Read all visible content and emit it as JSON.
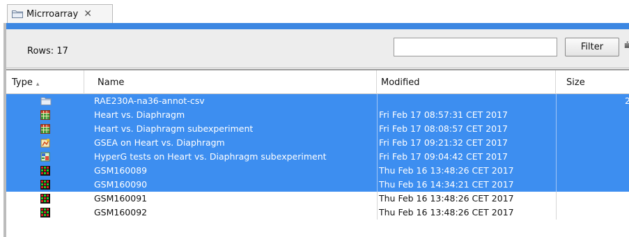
{
  "tab": {
    "label": "Micrroarray",
    "close": "✕"
  },
  "toolbar": {
    "rows_label": "Rows: 17",
    "filter_value": "",
    "filter_button": "Filter"
  },
  "columns": {
    "type": "Type",
    "name": "Name",
    "modified": "Modified",
    "size": "Size"
  },
  "colors": {
    "selection": "#3d8ef0",
    "header_bar": "#3c87e2"
  },
  "rows": [
    {
      "icon": "folder-icon",
      "name": "RAE230A-na36-annot-csv",
      "modified": "",
      "size": "2",
      "selected": true
    },
    {
      "icon": "table-grid-icon",
      "name": "Heart vs. Diaphragm",
      "modified": "Fri Feb 17 08:57:31 CET 2017",
      "size": "",
      "selected": true
    },
    {
      "icon": "table-grid-icon",
      "name": "Heart vs. Diaphragm subexperiment",
      "modified": "Fri Feb 17 08:08:57 CET 2017",
      "size": "",
      "selected": true
    },
    {
      "icon": "gsea-analysis-icon",
      "name": "GSEA on Heart vs. Diaphragm",
      "modified": "Fri Feb 17 09:21:32 CET 2017",
      "size": "",
      "selected": true
    },
    {
      "icon": "hyperg-analysis-icon",
      "name": "HyperG tests on Heart vs. Diaphragm subexperiment",
      "modified": "Fri Feb 17 09:04:42 CET 2017",
      "size": "",
      "selected": true
    },
    {
      "icon": "microarray-chip-icon",
      "name": "GSM160089",
      "modified": "Thu Feb 16 13:48:26 CET 2017",
      "size": "",
      "selected": true
    },
    {
      "icon": "microarray-chip-icon",
      "name": "GSM160090",
      "modified": "Thu Feb 16 14:34:21 CET 2017",
      "size": "",
      "selected": true
    },
    {
      "icon": "microarray-chip-icon",
      "name": "GSM160091",
      "modified": "Thu Feb 16 13:48:26 CET 2017",
      "size": "",
      "selected": false
    },
    {
      "icon": "microarray-chip-icon",
      "name": "GSM160092",
      "modified": "Thu Feb 16 13:48:26 CET 2017",
      "size": "",
      "selected": false
    }
  ]
}
